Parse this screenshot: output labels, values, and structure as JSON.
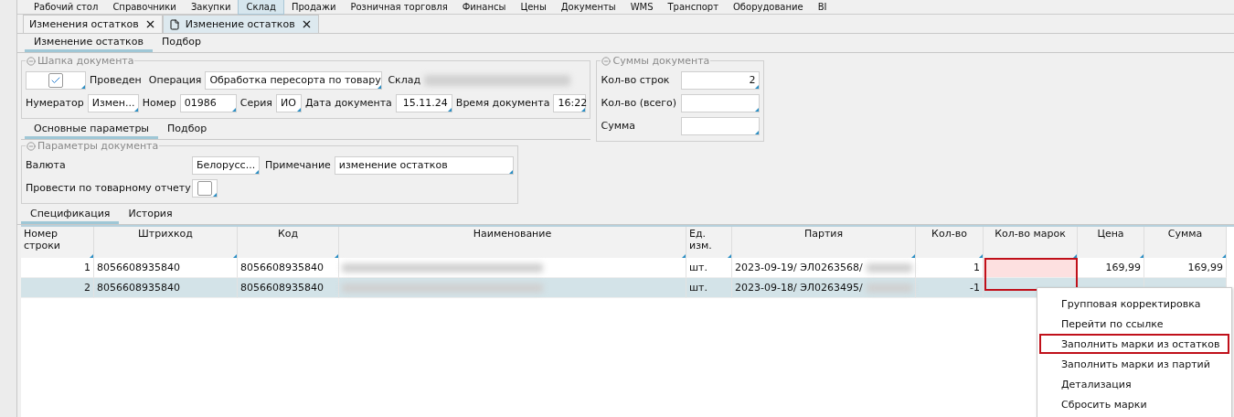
{
  "menu": [
    {
      "label": "Рабочий стол",
      "selected": false
    },
    {
      "label": "Справочники",
      "selected": false
    },
    {
      "label": "Закупки",
      "selected": false
    },
    {
      "label": "Склад",
      "selected": true
    },
    {
      "label": "Продажи",
      "selected": false
    },
    {
      "label": "Розничная торговля",
      "selected": false
    },
    {
      "label": "Финансы",
      "selected": false
    },
    {
      "label": "Цены",
      "selected": false
    },
    {
      "label": "Документы",
      "selected": false
    },
    {
      "label": "WMS",
      "selected": false
    },
    {
      "label": "Транспорт",
      "selected": false
    },
    {
      "label": "Оборудование",
      "selected": false
    },
    {
      "label": "BI",
      "selected": false
    }
  ],
  "doc_tabs": [
    {
      "label": "Изменения остатков",
      "selected": false,
      "kind": "list"
    },
    {
      "label": "Изменение остатков",
      "selected": true,
      "kind": "document"
    }
  ],
  "form_tabs": [
    {
      "label": "Изменение остатков",
      "selected": true
    },
    {
      "label": "Подбор",
      "selected": false
    }
  ],
  "header_group": {
    "title": "Шапка документа",
    "posted": {
      "label": "Проведен",
      "checked": true
    },
    "operation": {
      "label": "Операция",
      "value": "Обработка пересорта по товару"
    },
    "warehouse": {
      "label": "Склад"
    },
    "row2": [
      {
        "label": "Нумератор",
        "value": "Измен...",
        "kind": "narrow"
      },
      {
        "label": "Номер",
        "value": "01986",
        "kind": "medium"
      },
      {
        "label": "Серия",
        "value": "ИО",
        "kind": "tiny"
      },
      {
        "label": "Дата документа",
        "value": "15.11.24",
        "kind": "date"
      },
      {
        "label": "Время документа",
        "value": "16:22",
        "kind": "time"
      }
    ]
  },
  "sums_group": {
    "title": "Суммы документа",
    "fields": [
      {
        "label": "Кол-во строк",
        "value": "2"
      },
      {
        "label": "Кол-во (всего)"
      },
      {
        "label": "Сумма"
      }
    ]
  },
  "inner_tabs": [
    {
      "label": "Основные параметры",
      "selected": true
    },
    {
      "label": "Подбор",
      "selected": false
    }
  ],
  "params_group": {
    "title": "Параметры документа",
    "currency": {
      "label": "Валюта",
      "value": "Белорусс..."
    },
    "note": {
      "label": "Примечание",
      "value": "изменение остатков"
    },
    "report": {
      "label": "Провести по товарному отчету",
      "checked": false
    }
  },
  "spec_tabs": [
    {
      "label": "Спецификация",
      "selected": true
    },
    {
      "label": "История",
      "selected": false
    }
  ],
  "table": {
    "columns": [
      "Номер строки",
      "Штрихкод",
      "Код",
      "Наименование",
      "Ед. изм.",
      "Партия",
      "Кол-во",
      "Кол-во марок",
      "Цена",
      "Сумма"
    ],
    "rows": [
      {
        "selected": false,
        "marks_missing": true,
        "cells": [
          "1",
          "8056608935840",
          "8056608935840",
          "",
          "шт.",
          "2023-09-19/ ЭЛ0263568/",
          "1",
          "",
          "169,99",
          "169,99"
        ]
      },
      {
        "selected": true,
        "marks_missing": false,
        "cells": [
          "2",
          "8056608935840",
          "8056608935840",
          "",
          "шт.",
          "2023-09-18/ ЭЛ0263495/",
          "-1",
          "",
          "",
          ""
        ]
      }
    ]
  },
  "context_menu": [
    {
      "label": "Групповая корректировка",
      "highlighted": false
    },
    {
      "label": "Перейти по ссылке",
      "highlighted": false
    },
    {
      "label": "Заполнить марки из остатков",
      "highlighted": true
    },
    {
      "label": "Заполнить марки из партий",
      "highlighted": false
    },
    {
      "label": "Детализация",
      "highlighted": false
    },
    {
      "label": "Сбросить марки",
      "highlighted": false
    }
  ]
}
